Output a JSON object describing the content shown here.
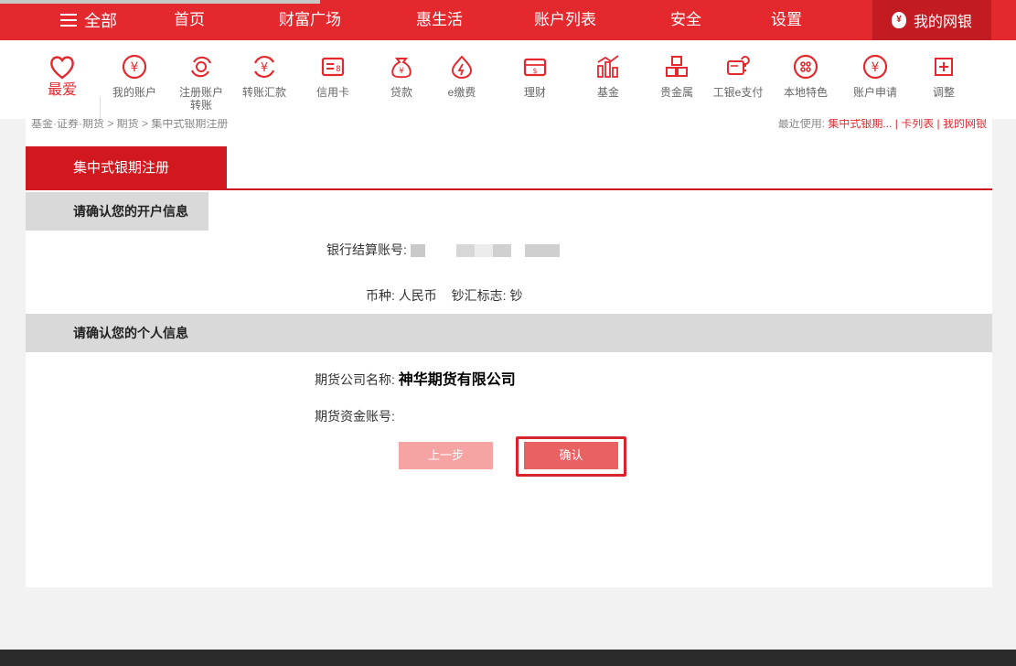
{
  "topnav": {
    "all_label": "全部",
    "items": [
      "首页",
      "财富广场",
      "惠生活",
      "账户列表",
      "安全",
      "设置"
    ],
    "mybank_label": "我的网银"
  },
  "iconbar": {
    "favorites_label": "最爱",
    "items": [
      {
        "label": "我的账户",
        "icon": "yen-circle-icon"
      },
      {
        "label": "注册账户\n转账",
        "icon": "transfer-register-icon"
      },
      {
        "label": "转账汇款",
        "icon": "yen-transfer-icon"
      },
      {
        "label": "信用卡",
        "icon": "credit-card-icon"
      },
      {
        "label": "贷款",
        "icon": "money-bag-icon"
      },
      {
        "label": "e缴费",
        "icon": "flame-icon"
      },
      {
        "label": "理财",
        "icon": "wallet-icon"
      },
      {
        "label": "基金",
        "icon": "chart-icon"
      },
      {
        "label": "贵金属",
        "icon": "gold-bars-icon"
      },
      {
        "label": "工银e支付",
        "icon": "epay-icon"
      },
      {
        "label": "本地特色",
        "icon": "local-icon"
      },
      {
        "label": "账户申请",
        "icon": "yen-apply-icon"
      },
      {
        "label": "调整",
        "icon": "plus-square-icon"
      }
    ],
    "accent": "#e3292e"
  },
  "breadcrumb": {
    "path": "基金·证券·期货 > 期货 > 集中式银期注册",
    "recent_label": "最近使用:",
    "recent_links": "集中式银期... | 卡列表 | 我的网银"
  },
  "panel": {
    "tab_label": "集中式银期注册",
    "section1_title": "请确认您的开户信息",
    "account_label": "银行结算账号:",
    "currency_label": "币种:",
    "currency_value": "人民币",
    "cash_flag_label": "钞汇标志:",
    "cash_flag_value": "钞",
    "section2_title": "请确认您的个人信息",
    "futures_company_label": "期货公司名称:",
    "futures_company_value": "神华期货有限公司",
    "futures_account_label": "期货资金账号:",
    "prev_button": "上一步",
    "confirm_button": "确认"
  }
}
